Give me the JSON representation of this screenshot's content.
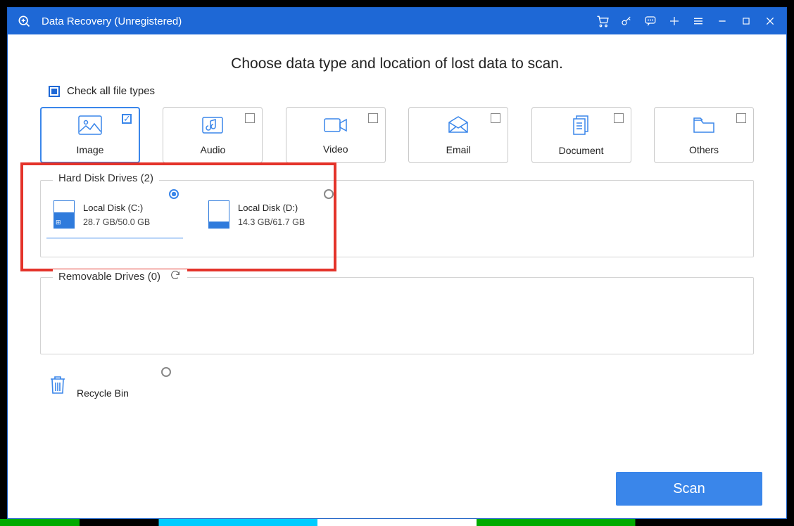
{
  "titlebar": {
    "title": "Data Recovery (Unregistered)"
  },
  "heading": "Choose data type and location of lost data to scan.",
  "checkall_label": "Check all file types",
  "file_types": [
    {
      "id": "image",
      "label": "Image",
      "checked": true
    },
    {
      "id": "audio",
      "label": "Audio",
      "checked": false
    },
    {
      "id": "video",
      "label": "Video",
      "checked": false
    },
    {
      "id": "email",
      "label": "Email",
      "checked": false
    },
    {
      "id": "document",
      "label": "Document",
      "checked": false
    },
    {
      "id": "others",
      "label": "Others",
      "checked": false
    }
  ],
  "drives_section": {
    "title": "Hard Disk Drives (2)",
    "drives": [
      {
        "name": "Local Disk (C:)",
        "size": "28.7 GB/50.0 GB",
        "fill_pct": 57,
        "system": true,
        "selected": true
      },
      {
        "name": "Local Disk (D:)",
        "size": "14.3 GB/61.7 GB",
        "fill_pct": 23,
        "system": false,
        "selected": false
      }
    ]
  },
  "removable_section": {
    "title": "Removable Drives (0)"
  },
  "recycle_label": "Recycle Bin",
  "scan_label": "Scan"
}
